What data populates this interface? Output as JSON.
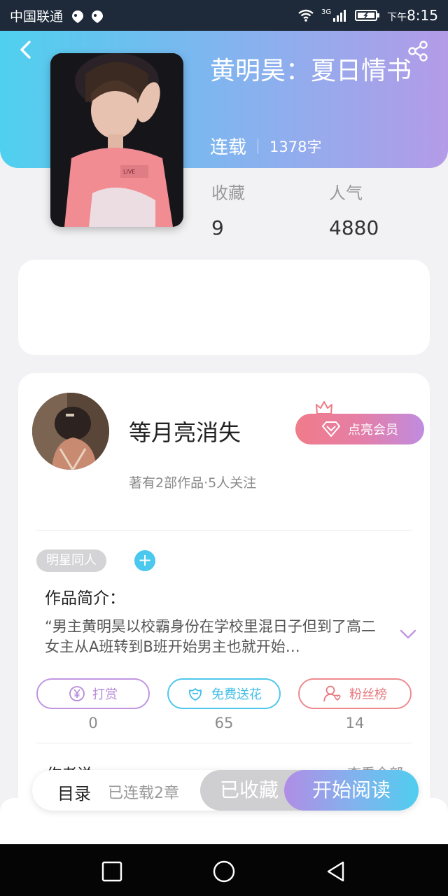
{
  "status_bar": {
    "carrier": "中国联通",
    "time_prefix": "下午",
    "time": "8:15",
    "network": "3G"
  },
  "book": {
    "title": "黄明昊：夏日情书",
    "status": "连载",
    "word_count": "1378字",
    "stats": {
      "collect_label": "收藏",
      "collect_value": "9",
      "popularity_label": "人气",
      "popularity_value": "4880"
    }
  },
  "author": {
    "name": "等月亮消失",
    "info": "著有2部作品·5人关注",
    "vip_button": "点亮会员"
  },
  "tags": [
    "明星同人"
  ],
  "tag_add_label": "+",
  "intro": {
    "title": "作品简介：",
    "text": "“男主黄明昊以校霸身份在学校里混日子但到了高二女主从A班转到B班开始男主也就开始…"
  },
  "actions": [
    {
      "label": "打赏",
      "count": "0",
      "icon": "yen-circle-icon"
    },
    {
      "label": "免费送花",
      "count": "65",
      "icon": "flower-icon"
    },
    {
      "label": "粉丝榜",
      "count": "14",
      "icon": "fans-icon"
    }
  ],
  "peek": {
    "left": "作者说",
    "right": "查看全部"
  },
  "toolbar": {
    "toc_label": "目录",
    "toc_sub": "已连载2章",
    "collected_label": "已收藏",
    "read_label": "开始阅读"
  },
  "colors": {
    "header_gradient": [
      "#4fd0ee",
      "#7cb7f0",
      "#b49be8"
    ],
    "accent_blue": "#4ac8ee",
    "accent_purple": "#b78ad8",
    "accent_pink": "#e77a80"
  }
}
